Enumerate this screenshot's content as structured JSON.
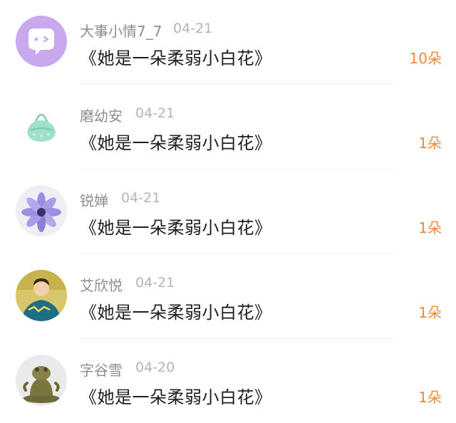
{
  "items": [
    {
      "name": "大事小情7_7",
      "date": "04-21",
      "title": "《她是一朵柔弱小白花》",
      "count": "10朵",
      "avatar_icon": "purple-chat-bubble-avatar"
    },
    {
      "name": "磨幼安",
      "date": "04-21",
      "title": "《她是一朵柔弱小白花》",
      "count": "1朵",
      "avatar_icon": "mint-handbag-avatar"
    },
    {
      "name": "锐婵",
      "date": "04-21",
      "title": "《她是一朵柔弱小白花》",
      "count": "1朵",
      "avatar_icon": "purple-flower-avatar"
    },
    {
      "name": "艾欣悦",
      "date": "04-21",
      "title": "《她是一朵柔弱小白花》",
      "count": "1朵",
      "avatar_icon": "person-photo-avatar"
    },
    {
      "name": "字谷雪",
      "date": "04-20",
      "title": "《她是一朵柔弱小白花》",
      "count": "1朵",
      "avatar_icon": "bronze-frog-statue-avatar"
    }
  ],
  "colors": {
    "count": "#ec8a3c",
    "name": "#8e8e8e",
    "date": "#b4b4b4",
    "title": "#1f1f1f"
  }
}
